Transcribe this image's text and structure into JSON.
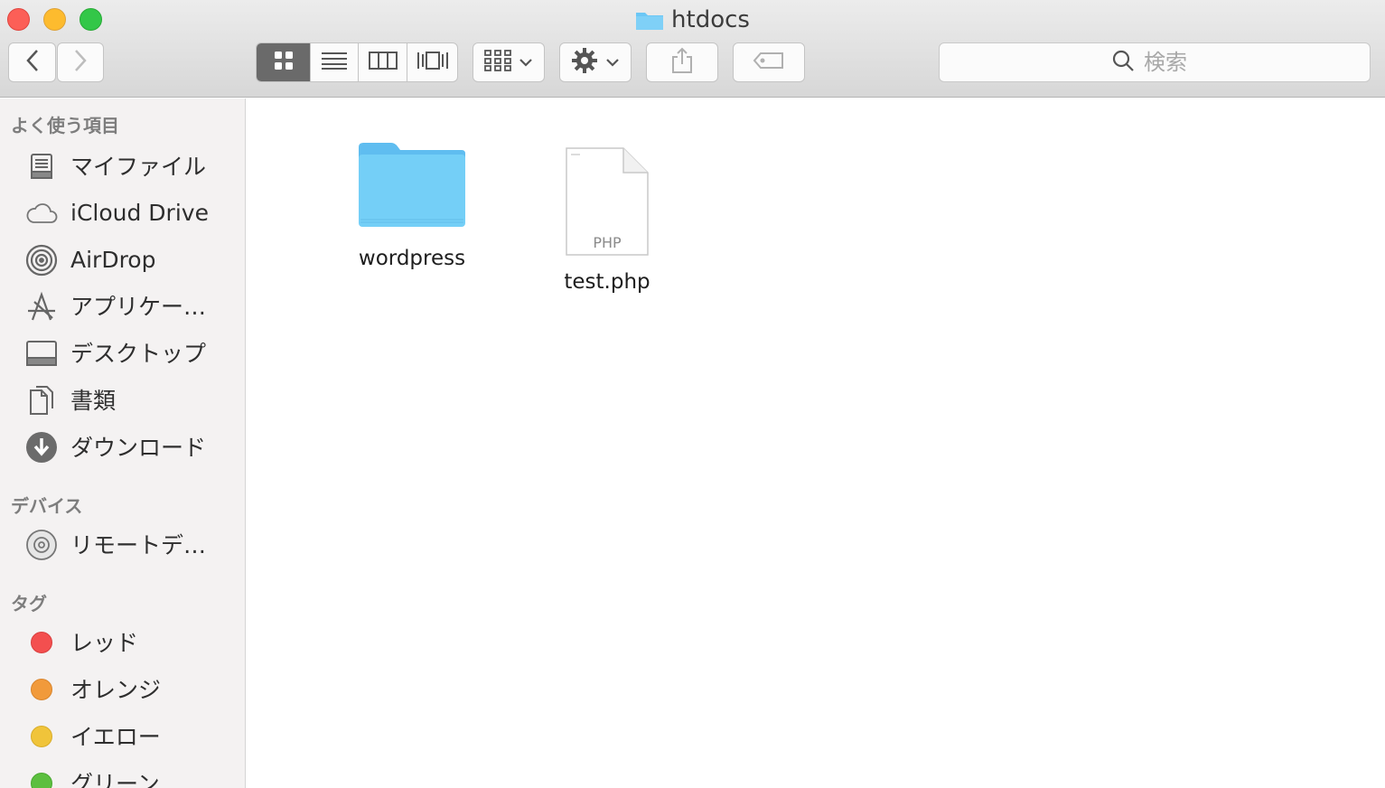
{
  "window": {
    "title": "htdocs"
  },
  "toolbar": {
    "back_icon": "chevron-left-icon",
    "forward_icon": "chevron-right-icon",
    "view_modes": [
      "icon-view",
      "list-view",
      "column-view",
      "cover-flow-view"
    ],
    "arrange_icon": "arrange-grid-icon",
    "action_icon": "gear-icon",
    "share_icon": "share-icon",
    "tag_icon": "tag-icon",
    "search_placeholder": "検索"
  },
  "sidebar": {
    "favorites_title": "よく使う項目",
    "favorites": [
      {
        "label": "マイファイル",
        "icon": "all-my-files-icon"
      },
      {
        "label": "iCloud Drive",
        "icon": "cloud-icon"
      },
      {
        "label": "AirDrop",
        "icon": "airdrop-icon"
      },
      {
        "label": "アプリケー…",
        "icon": "applications-icon"
      },
      {
        "label": "デスクトップ",
        "icon": "desktop-icon"
      },
      {
        "label": "書類",
        "icon": "documents-icon"
      },
      {
        "label": "ダウンロード",
        "icon": "downloads-icon"
      }
    ],
    "devices_title": "デバイス",
    "devices": [
      {
        "label": "リモートデ…",
        "icon": "remote-disc-icon"
      }
    ],
    "tags_title": "タグ",
    "tags": [
      {
        "label": "レッド",
        "color": "#f34f4f"
      },
      {
        "label": "オレンジ",
        "color": "#f19a3b"
      },
      {
        "label": "イエロー",
        "color": "#f0c43a"
      },
      {
        "label": "グリーン",
        "color": "#5cbf3f"
      }
    ]
  },
  "files": [
    {
      "name": "wordpress",
      "kind": "folder",
      "icon": "folder-icon"
    },
    {
      "name": "test.php",
      "kind": "document",
      "icon": "php-file-icon",
      "badge": "PHP"
    }
  ],
  "colors": {
    "folder": "#6cc7f5",
    "sidebar_bg": "#f4f2f2"
  }
}
